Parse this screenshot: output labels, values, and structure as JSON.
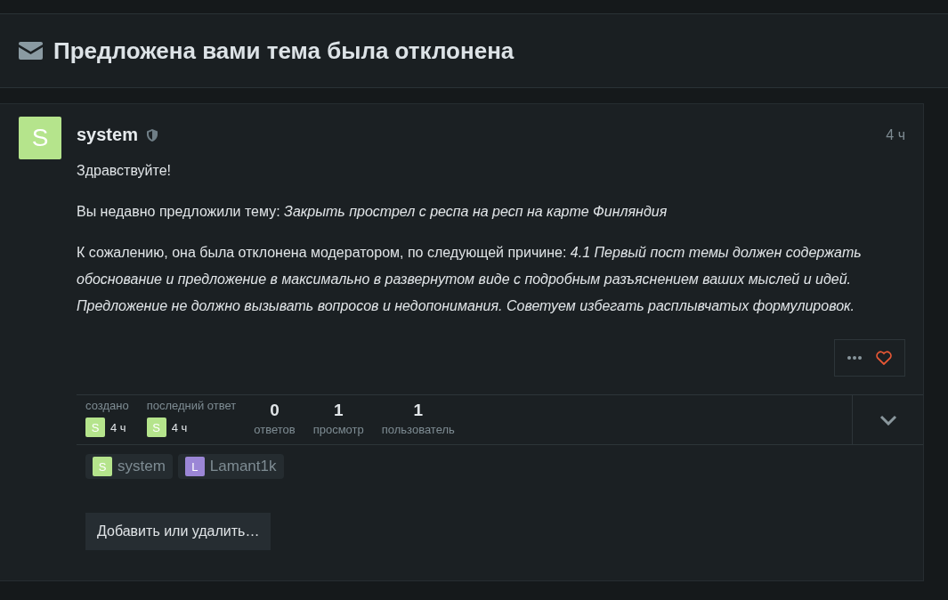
{
  "header": {
    "title": "Предложена вами тема была отклонена"
  },
  "post": {
    "author": {
      "letter": "S",
      "name": "system",
      "color": "#b5e48c"
    },
    "time": "4 ч",
    "paragraphs": [
      "Здравствуйте!",
      "Вы недавно предложили тему: *Закрыть прострел с респа на респ на карте Финляндия*",
      "К сожалению, она была отклонена модератором, по следующей причине: *4.1 Первый пост темы должен содержать обоснование и предложение в максимально в развернутом виде с подробным разъяснением ваших мыслей и идей. Предложение не должно вызывать вопросов и недопонимания. Советуем избегать расплывчатых формулировок.*"
    ],
    "liked": false
  },
  "summary": {
    "dates": [
      {
        "label": "создано",
        "letter": "S",
        "color": "#b5e48c",
        "time": "4 ч"
      },
      {
        "label": "последний ответ",
        "letter": "S",
        "color": "#b5e48c",
        "time": "4 ч"
      }
    ],
    "stats": [
      {
        "value": "0",
        "label": "ответов"
      },
      {
        "value": "1",
        "label": "просмотр"
      },
      {
        "value": "1",
        "label": "пользователь"
      }
    ],
    "expanded": false
  },
  "participants": [
    {
      "letter": "S",
      "name": "system",
      "color": "#b5e48c"
    },
    {
      "letter": "L",
      "name": "Lamant1k",
      "color": "#9b86d6"
    }
  ],
  "add_button": "Добавить или удалить…"
}
